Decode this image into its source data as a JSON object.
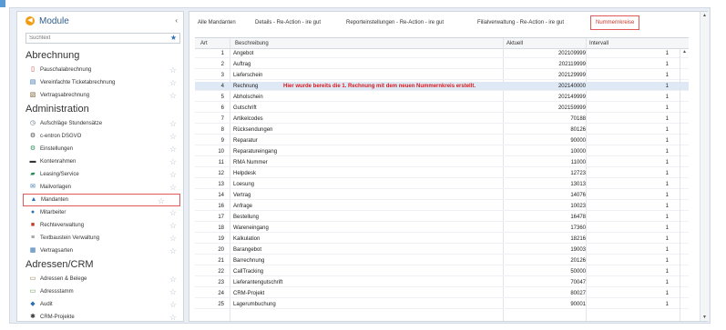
{
  "sidebar": {
    "title": "Module",
    "search_placeholder": "Suchtext",
    "sections": [
      {
        "title": "Abrechnung",
        "items": [
          {
            "label": "Pauschalabrechnung",
            "icon": "document-icon"
          },
          {
            "label": "Vereinfachte Ticketabrechnung",
            "icon": "ticket-icon"
          },
          {
            "label": "Vertragsabrechnung",
            "icon": "contract-icon"
          }
        ]
      },
      {
        "title": "Administration",
        "items": [
          {
            "label": "Aufschläge Stundensätze",
            "icon": "clock-icon"
          },
          {
            "label": "c-entron DSGVO",
            "icon": "gear-icon"
          },
          {
            "label": "Einstellungen",
            "icon": "settings-icon"
          },
          {
            "label": "Kontenrahmen",
            "icon": "folder-icon"
          },
          {
            "label": "Leasing/Service",
            "icon": "leasing-icon"
          },
          {
            "label": "Mailvorlagen",
            "icon": "mail-icon"
          },
          {
            "label": "Mandanten",
            "icon": "building-icon",
            "selected": true
          },
          {
            "label": "Mitarbeiter",
            "icon": "user-icon"
          },
          {
            "label": "Rechteverwaltung",
            "icon": "lock-icon"
          },
          {
            "label": "Textbaustein Verwaltung",
            "icon": "text-icon"
          },
          {
            "label": "Vertragsarten",
            "icon": "contract-type-icon"
          }
        ]
      },
      {
        "title": "Adressen/CRM",
        "items": [
          {
            "label": "Adressen & Belege",
            "icon": "address-icon"
          },
          {
            "label": "Adressstamm",
            "icon": "address-book-icon"
          },
          {
            "label": "Audit",
            "icon": "audit-icon"
          },
          {
            "label": "CRM-Projekte",
            "icon": "crm-icon"
          }
        ]
      }
    ]
  },
  "tabs": [
    {
      "label": "Alle Mandanten"
    },
    {
      "label": "Details - Re-Action - ire gut"
    },
    {
      "label": "Reporteinstellungen - Re-Action - ire gut"
    },
    {
      "label": "Filialverwaltung - Re-Action - ire gut"
    },
    {
      "label": "Nummernkreise",
      "active": true
    }
  ],
  "grid": {
    "columns": {
      "art": "Art",
      "beschreibung": "Beschreibung",
      "aktuell": "Aktuell",
      "intervall": "Intervall"
    },
    "annotation": "Hier wurde bereits die 1. Rechnung mit dem neuen Nummernkreis erstellt.",
    "rows": [
      {
        "art": "1",
        "beschreibung": "Angebot",
        "aktuell": "202109999",
        "intervall": "1"
      },
      {
        "art": "2",
        "beschreibung": "Auftrag",
        "aktuell": "202119999",
        "intervall": "1"
      },
      {
        "art": "3",
        "beschreibung": "Lieferschein",
        "aktuell": "202129999",
        "intervall": "1"
      },
      {
        "art": "4",
        "beschreibung": "Rechnung",
        "aktuell": "202140000",
        "intervall": "1",
        "selected": true
      },
      {
        "art": "5",
        "beschreibung": "Abholschein",
        "aktuell": "202149999",
        "intervall": "1"
      },
      {
        "art": "6",
        "beschreibung": "Gutschrift",
        "aktuell": "202159999",
        "intervall": "1"
      },
      {
        "art": "7",
        "beschreibung": "Artikelcodes",
        "aktuell": "70188",
        "intervall": "1"
      },
      {
        "art": "8",
        "beschreibung": "Rücksendungen",
        "aktuell": "80126",
        "intervall": "1"
      },
      {
        "art": "9",
        "beschreibung": "Reparatur",
        "aktuell": "90000",
        "intervall": "1"
      },
      {
        "art": "10",
        "beschreibung": "Reparatureingang",
        "aktuell": "10000",
        "intervall": "1"
      },
      {
        "art": "11",
        "beschreibung": "RMA Nummer",
        "aktuell": "11000",
        "intervall": "1"
      },
      {
        "art": "12",
        "beschreibung": "Helpdesk",
        "aktuell": "12723",
        "intervall": "1"
      },
      {
        "art": "13",
        "beschreibung": "Loesung",
        "aktuell": "13013",
        "intervall": "1"
      },
      {
        "art": "14",
        "beschreibung": "Vertrag",
        "aktuell": "14076",
        "intervall": "1"
      },
      {
        "art": "16",
        "beschreibung": "Anfrage",
        "aktuell": "10023",
        "intervall": "1"
      },
      {
        "art": "17",
        "beschreibung": "Bestellung",
        "aktuell": "16478",
        "intervall": "1"
      },
      {
        "art": "18",
        "beschreibung": "Wareneingang",
        "aktuell": "17360",
        "intervall": "1"
      },
      {
        "art": "19",
        "beschreibung": "Kalkulation",
        "aktuell": "18216",
        "intervall": "1"
      },
      {
        "art": "20",
        "beschreibung": "Barangebot",
        "aktuell": "19003",
        "intervall": "1"
      },
      {
        "art": "21",
        "beschreibung": "Barrechnung",
        "aktuell": "20126",
        "intervall": "1"
      },
      {
        "art": "22",
        "beschreibung": "CallTracking",
        "aktuell": "50000",
        "intervall": "1"
      },
      {
        "art": "23",
        "beschreibung": "Lieferantengutschrift",
        "aktuell": "70047",
        "intervall": "1"
      },
      {
        "art": "24",
        "beschreibung": "CRM-Projekt",
        "aktuell": "80027",
        "intervall": "1"
      },
      {
        "art": "25",
        "beschreibung": "Lagerumbuchung",
        "aktuell": "90001",
        "intervall": "1"
      }
    ]
  },
  "colors": {
    "accent": "#2f5d8a",
    "highlight_border": "#e05a5a",
    "annotation": "#d9191c",
    "selected_row": "#dfe9f5"
  }
}
